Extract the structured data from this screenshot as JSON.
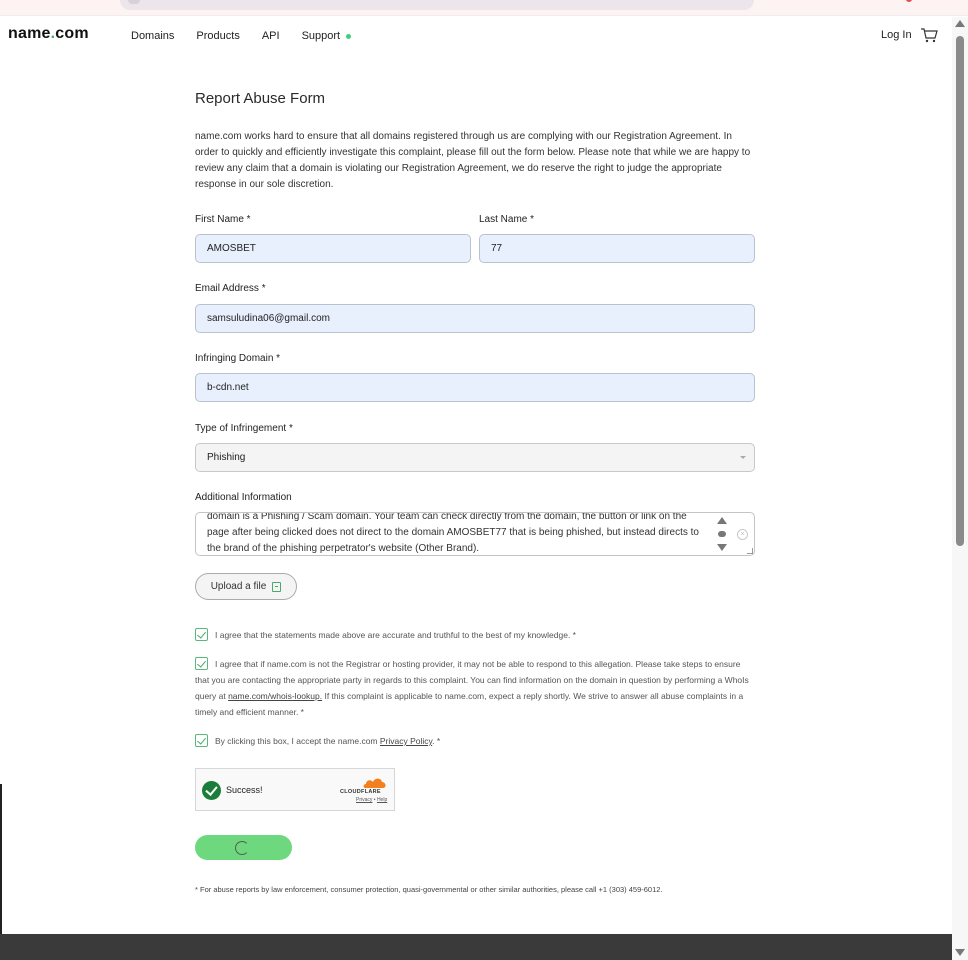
{
  "header": {
    "logo_prefix": "name",
    "logo_dot": ".",
    "logo_suffix": "com",
    "nav": [
      "Domains",
      "Products",
      "API",
      "Support"
    ],
    "login_label": "Log In"
  },
  "form": {
    "title": "Report Abuse Form",
    "intro": "name.com works hard to ensure that all domains registered through us are complying with our Registration Agreement. In order to quickly and efficiently investigate this complaint, please fill out the form below. Please note that while we are happy to review any claim that a domain is violating our Registration Agreement, we do reserve the right to judge the appropriate response in our sole discretion.",
    "first_name": {
      "label": "First Name *",
      "value": "AMOSBET"
    },
    "last_name": {
      "label": "Last Name *",
      "value": "77"
    },
    "email": {
      "label": "Email Address *",
      "value": "samsuludina06@gmail.com"
    },
    "domain": {
      "label": "Infringing Domain *",
      "value": "b-cdn.net"
    },
    "infringement_type": {
      "label": "Type of Infringement *",
      "value": "Phishing"
    },
    "additional_info": {
      "label": "Additional Information",
      "value": "domain is a Phishing / Scam domain. Your team can check directly from the domain, the button or link on the page after being clicked does not direct to the domain AMOSBET77 that is being phished, but instead directs to the brand of the phishing perpetrator's website (Other Brand)."
    },
    "upload_label": "Upload a file",
    "checks": {
      "c1": "I agree that the statements made above are accurate and truthful to the best of my knowledge. *",
      "c2_a": "I agree that if name.com is not the Registrar or hosting provider, it may not be able to respond to this allegation. Please take steps to ensure that you are contacting the appropriate party in regards to this complaint. You can find information on the domain in question by performing a WhoIs query at ",
      "c2_link": "name.com/whois-lookup.",
      "c2_b": " If this complaint is applicable to name.com, expect a reply shortly. We strive to answer all abuse complaints in a timely and efficient manner. *",
      "c3_a": "By clicking this box, I accept the name.com ",
      "c3_link": "Privacy Policy",
      "c3_b": ". *"
    },
    "captcha": {
      "status": "Success!",
      "brand": "CLOUDFLARE",
      "privacy": "Privacy",
      "sep": " • ",
      "help": "Help"
    },
    "footnote": "* For abuse reports by law enforcement, consumer protection, quasi-governmental or other similar authorities, please call +1 (303) 459-6012."
  },
  "colors": {
    "accent_green": "#6ed87f",
    "input_fill": "#e8f0fe",
    "footer": "#3a3a3a"
  }
}
